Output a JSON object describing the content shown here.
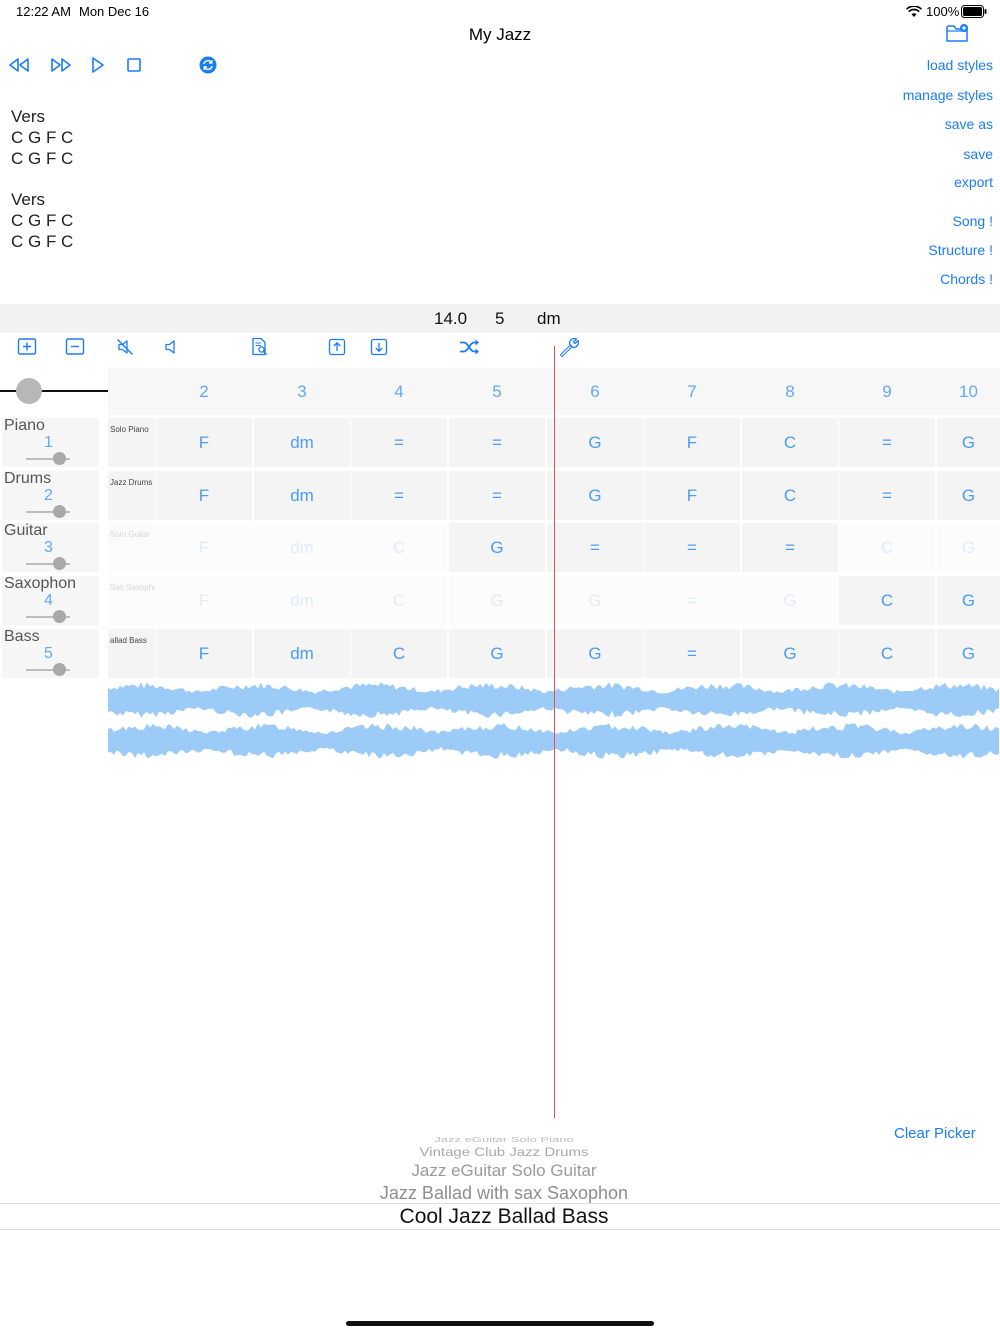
{
  "status_bar": {
    "time": "12:22 AM",
    "date": "Mon Dec 16",
    "battery": "100%"
  },
  "header": {
    "title": "My Jazz"
  },
  "toolbar": {
    "icons": [
      "rewind-icon",
      "fast-forward-icon",
      "play-icon",
      "stop-icon",
      "refresh-icon",
      "folder-add-icon"
    ]
  },
  "side_menu": {
    "load_styles": "load styles",
    "manage_styles": "manage styles",
    "save_as": "save as",
    "save": "save",
    "export": "export",
    "song": "Song !",
    "structure": "Structure !",
    "chords": "Chords !"
  },
  "song_text": {
    "sections": [
      {
        "label": "Vers",
        "lines": [
          "C G F C",
          "C G F C"
        ]
      },
      {
        "label": "Vers",
        "lines": [
          "C G F C",
          "C G F C"
        ]
      }
    ]
  },
  "info_bar": {
    "tempo": "14.0",
    "bar": "5",
    "chord": "dm"
  },
  "edit_toolbar": {
    "icons": [
      "add-square-icon",
      "remove-square-icon",
      "mute-icon",
      "speaker-icon",
      "doc-search-icon",
      "upload-icon",
      "download-icon",
      "shuffle-icon",
      "wrench-icon"
    ]
  },
  "zoom": {
    "level": 0.2
  },
  "grid": {
    "columns": [
      "2",
      "3",
      "4",
      "5",
      "6",
      "7",
      "8",
      "9",
      "10"
    ],
    "tracks": [
      {
        "name": "Piano",
        "number": "1",
        "style": "Solo Piano",
        "volume": 0.75,
        "cells": [
          "F",
          "dm",
          "=",
          "=",
          "G",
          "F",
          "C",
          "=",
          "G"
        ],
        "active": [
          true,
          true,
          true,
          true,
          true,
          true,
          true,
          true,
          true
        ]
      },
      {
        "name": "Drums",
        "number": "2",
        "style": "Jazz Drums",
        "volume": 0.75,
        "cells": [
          "F",
          "dm",
          "=",
          "=",
          "G",
          "F",
          "C",
          "=",
          "G"
        ],
        "active": [
          true,
          true,
          true,
          true,
          true,
          true,
          true,
          true,
          true
        ]
      },
      {
        "name": "Guitar",
        "number": "3",
        "style": "Solo Guitar",
        "volume": 0.75,
        "cells": [
          "F",
          "dm",
          "C",
          "G",
          "=",
          "=",
          "=",
          "C",
          "G"
        ],
        "active": [
          false,
          false,
          false,
          true,
          true,
          true,
          true,
          false,
          false
        ]
      },
      {
        "name": "Saxophon",
        "number": "4",
        "style": "Sax Saxophon",
        "volume": 0.75,
        "cells": [
          "F",
          "dm",
          "C",
          "G",
          "G",
          "=",
          "G",
          "C",
          "G"
        ],
        "active": [
          false,
          false,
          false,
          false,
          false,
          false,
          false,
          true,
          true
        ]
      },
      {
        "name": "Bass",
        "number": "5",
        "style": "allad Bass",
        "volume": 0.75,
        "cells": [
          "F",
          "dm",
          "C",
          "G",
          "G",
          "=",
          "G",
          "C",
          "G"
        ],
        "active": [
          true,
          true,
          true,
          true,
          true,
          true,
          true,
          true,
          true
        ]
      }
    ]
  },
  "picker": {
    "clear_label": "Clear Picker",
    "items": [
      "Jazz eGuitar Solo Piano",
      "Vintage Club Jazz Drums",
      "Jazz eGuitar Solo Guitar",
      "Jazz Ballad with sax Saxophon",
      "Cool Jazz Ballad Bass"
    ],
    "selected_index": 4
  },
  "colors": {
    "accent": "#1a7df5",
    "cell_text": "#4a9cf5",
    "waveform": "#9ccbf7",
    "playhead": "#e85050"
  }
}
